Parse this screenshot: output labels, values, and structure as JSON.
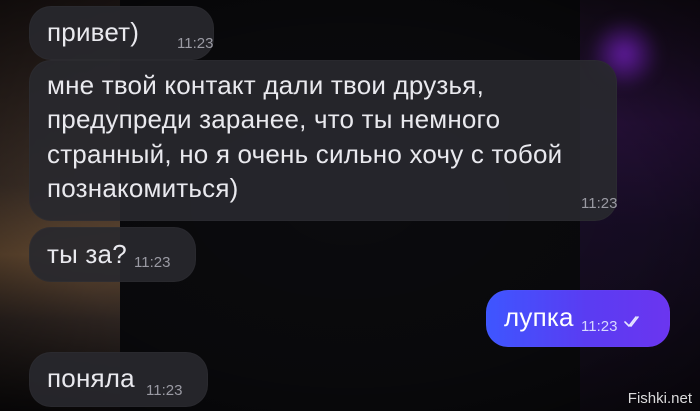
{
  "messages": [
    {
      "text": "привет)",
      "time": "11:23"
    },
    {
      "text": "мне твой контакт дали твои друзья, предупреди заранее, что ты немного странный, но я очень сильно хочу с тобой познакомиться)",
      "time": "11:23"
    },
    {
      "text": "ты за?",
      "time": "11:23"
    },
    {
      "text": "лупка",
      "time": "11:23",
      "status": "read-double-check-icon"
    },
    {
      "text": "поняла",
      "time": "11:23"
    }
  ],
  "watermark": "Fishki.net",
  "colors": {
    "incoming_bubble": "#28282e",
    "outgoing_gradient_start": "#3e56ff",
    "outgoing_gradient_end": "#6b35f0",
    "background": "#0b0b0e"
  }
}
